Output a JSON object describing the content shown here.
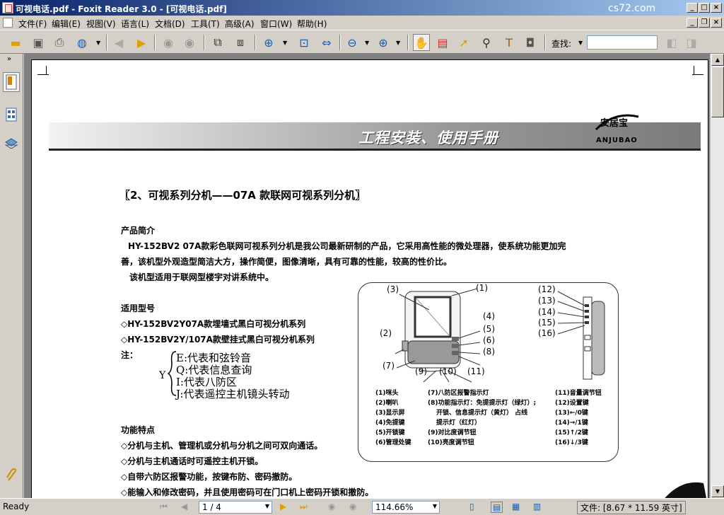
{
  "window": {
    "title": "可视电话.pdf - Foxit Reader 3.0 - [可视电话.pdf]",
    "watermark": "cs72.com"
  },
  "menu": [
    "文件(F)",
    "编辑(E)",
    "视图(V)",
    "语言(L)",
    "文档(D)",
    "工具(T)",
    "高级(A)",
    "窗口(W)",
    "帮助(H)"
  ],
  "toolbar": {
    "icons": [
      "open-icon",
      "save-icon",
      "print-icon",
      "email-icon",
      "prev-page-icon",
      "next-page-icon",
      "back-icon",
      "forward-icon",
      "extract-icon",
      "insert-icon",
      "zoom-in-icon",
      "fit-page-icon",
      "fit-width-icon",
      "zoom-out-minus-icon",
      "zoom-in-plus-icon",
      "hand-tool-icon",
      "snapshot-icon",
      "select-icon",
      "find-icon",
      "typewriter-icon",
      "camera-icon"
    ],
    "find_label": "查找:",
    "find_value": ""
  },
  "status": {
    "ready": "Ready",
    "page": "1 / 4",
    "zoom": "114.66%",
    "file_info": "文件: [8.67 * 11.59 英寸]"
  },
  "doc": {
    "banner_title": "工程安装、使用手册",
    "logo_cn": "安居宝",
    "logo_en": "ANJUBAO",
    "heading": "〖2、可视系列分机——07A  款联网可视系列分机〗",
    "intro_title": "产品简介",
    "intro_p1": "HY-152BV2   07A款彩色联网可视系列分机是我公司最新研制的产品，它采用高性能的微处理器，使系统功能更加完",
    "intro_p2": "善，该机型外观造型简洁大方，操作简便，图像清晰，具有可靠的性能，较高的性价比。",
    "intro_p3": "该机型适用于联网型楼宇对讲系统中。",
    "models_title": "适用型号",
    "model1": "◇HY-152BV2Y07A款埋墙式黑白可视分机系列",
    "model2": "◇HY-152BV2Y/107A款壁挂式黑白可视分机系列",
    "note": "注：",
    "y_label": "Y",
    "note_e": "E:代表和弦铃音",
    "note_q": "Q:代表信息查询",
    "note_i": "I:代表八防区",
    "note_j": "J:代表遥控主机镜头转动",
    "features_title": "功能特点",
    "feat1": "◇分机与主机、管理机或分机与分机之间可双向通话。",
    "feat2": "◇分机与主机通话时可遥控主机开锁。",
    "feat3": "◇自带六防区报警功能，按键布防、密码撤防。",
    "feat4": "◇能输入和修改密码，并且使用密码可在门口机上密码开锁和撤防。",
    "diagram_labels": [
      "(1)",
      "(2)",
      "(3)",
      "(4)",
      "(5)",
      "(6)",
      "(7)",
      "(8)",
      "(9)",
      "(10)",
      "(11)",
      "(12)",
      "(13)",
      "(14)",
      "(15)",
      "(16)"
    ],
    "legend_col1": [
      "(1)咪头",
      "(2)喇叭",
      "(3)显示屏",
      "(4)免提键",
      "(5)开锁键",
      "(6)管理处键"
    ],
    "legend_col2": [
      "(7)八防区报警指示灯",
      "(8)功能指示灯：免提提示灯（绿灯）;",
      "开锁、信息提示灯（黄灯）  占线",
      "提示灯（红灯）",
      "(9)对比度调节钮",
      "(10)亮度调节钮"
    ],
    "legend_col3": [
      "(11)音量调节钮",
      "(12)设置键",
      "(13)←/0键",
      "(14)→/1键",
      "(15)↑/2键",
      "(16)↓/3键"
    ]
  }
}
